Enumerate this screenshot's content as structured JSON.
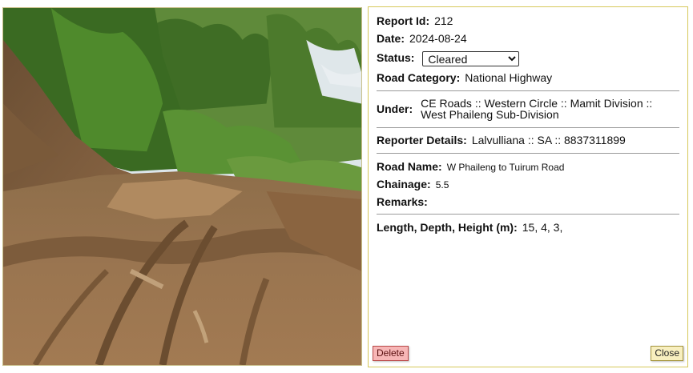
{
  "report": {
    "id_label": "Report Id:",
    "id_value": "212",
    "date_label": "Date:",
    "date_value": "2024-08-24",
    "status_label": "Status:",
    "status_value": "Cleared",
    "road_category_label": "Road Category:",
    "road_category_value": "National Highway",
    "under_label": "Under:",
    "under_value": "CE Roads :: Western Circle :: Mamit Division :: West Phaileng Sub-Division",
    "reporter_label": "Reporter Details:",
    "reporter_value": "Lalvulliana :: SA :: 8837311899",
    "road_name_label": "Road Name:",
    "road_name_value": "W Phaileng to Tuirum Road",
    "chainage_label": "Chainage:",
    "chainage_value": "5.5",
    "remarks_label": "Remarks:",
    "remarks_value": "",
    "dimensions_label": "Length, Depth, Height (m):",
    "dimensions_value": "15, 4, 3,"
  },
  "buttons": {
    "delete_label": "Delete",
    "close_label": "Close"
  },
  "photo": {
    "subject": "landslide-debris-on-road-photo"
  },
  "colors": {
    "panel_border": "#d6c85a",
    "delete_bg": "#f7b6b6",
    "close_bg": "#f8efbf"
  }
}
